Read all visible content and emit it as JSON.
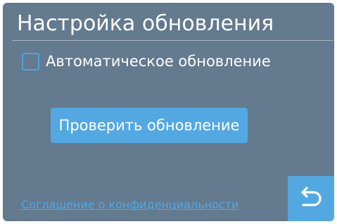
{
  "header": {
    "title": "Настройка обновления"
  },
  "auto_update": {
    "label": "Автоматическое обновление",
    "checked": false
  },
  "actions": {
    "check_update_label": "Проверить обновление"
  },
  "footer": {
    "privacy_link": "Соглашение о конфиденциальности",
    "back_icon": "return-arrow-icon"
  },
  "colors": {
    "background": "#637a8f",
    "accent": "#53a8e2",
    "link": "#4fa8e6",
    "text": "#ffffff"
  }
}
